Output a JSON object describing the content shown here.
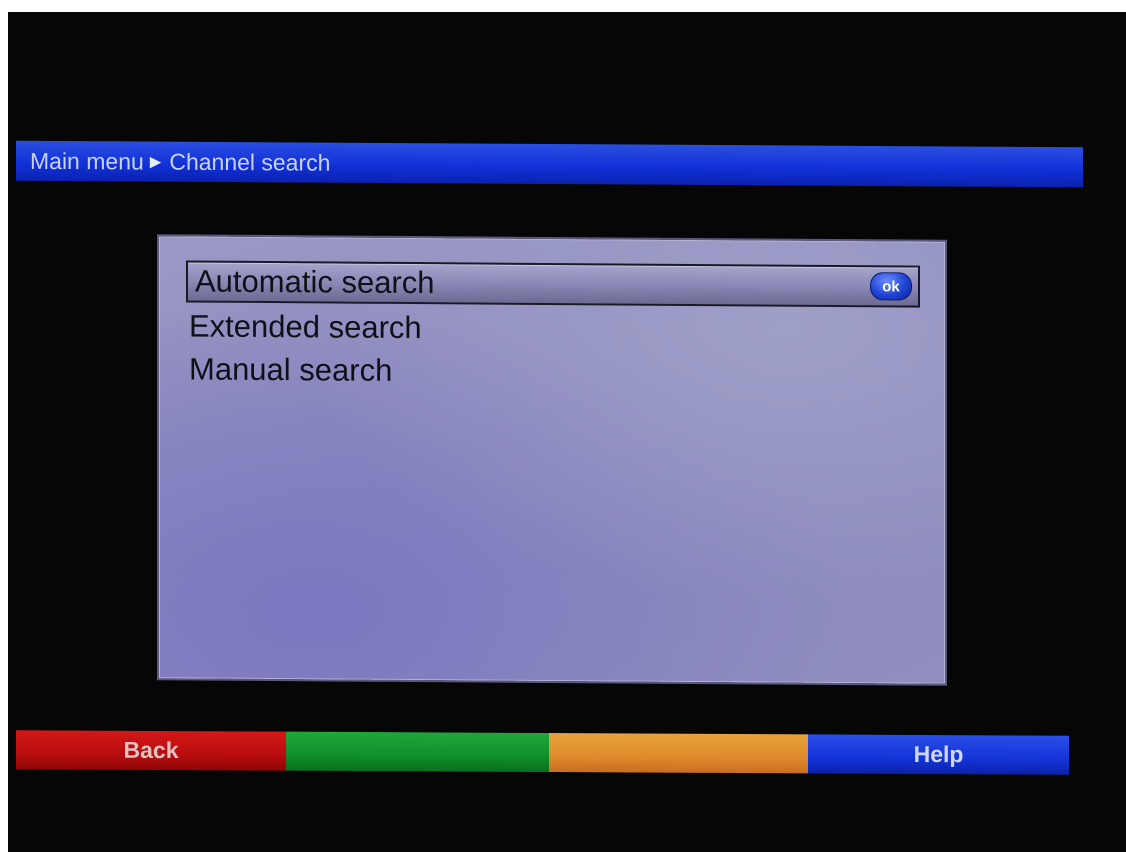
{
  "breadcrumb": {
    "root": "Main menu",
    "separator_icon": "triangle-right-icon",
    "separator_glyph": "▶",
    "current": "Channel search"
  },
  "menu": {
    "items": [
      {
        "label": "Automatic search",
        "selected": true
      },
      {
        "label": "Extended search",
        "selected": false
      },
      {
        "label": "Manual search",
        "selected": false
      }
    ],
    "ok_badge": "ok"
  },
  "keys": {
    "red": {
      "label": "Back",
      "color": "#c01010"
    },
    "green": {
      "label": "",
      "color": "#15972f"
    },
    "yellow": {
      "label": "",
      "color": "#e28f2e"
    },
    "blue": {
      "label": "Help",
      "color": "#1636da"
    }
  }
}
